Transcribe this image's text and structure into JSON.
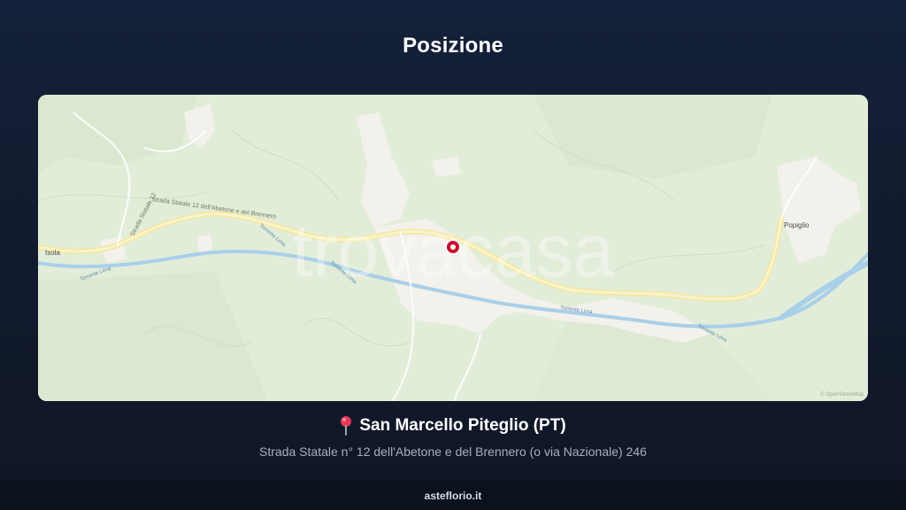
{
  "header": {
    "title": "Posizione"
  },
  "map": {
    "watermark": "trovacasa",
    "place_labels": {
      "isola": "Isola",
      "popiglio": "Popiglio"
    },
    "road_labels": {
      "ss12": "Strada Statale 12 dell'Abetone e del Brennero",
      "ss12_short": "Strada Statale 12",
      "torrente_lima": "Torrente Lima",
      "torrente_lima_2": "Torrente Lima",
      "torrente_lima_3": "Torrente Lima",
      "torrente_lima_4": "Torrente Lima",
      "torrente_lima_5": "Torrente Lima"
    },
    "attribution": "© OpenStreetMap",
    "colors": {
      "land": "#e4eedc",
      "road": "#f4e7a1",
      "urban": "#f3f1ec",
      "river": "#a9cfe9",
      "marker": "#c8102e"
    }
  },
  "location": {
    "pin_icon": "round-pushpin-icon",
    "name": "San Marcello Piteglio (PT)",
    "address": "Strada Statale n° 12 dell'Abetone e del Brennero (o via Nazionale) 246"
  },
  "footer": {
    "site": "asteflorio.it"
  }
}
